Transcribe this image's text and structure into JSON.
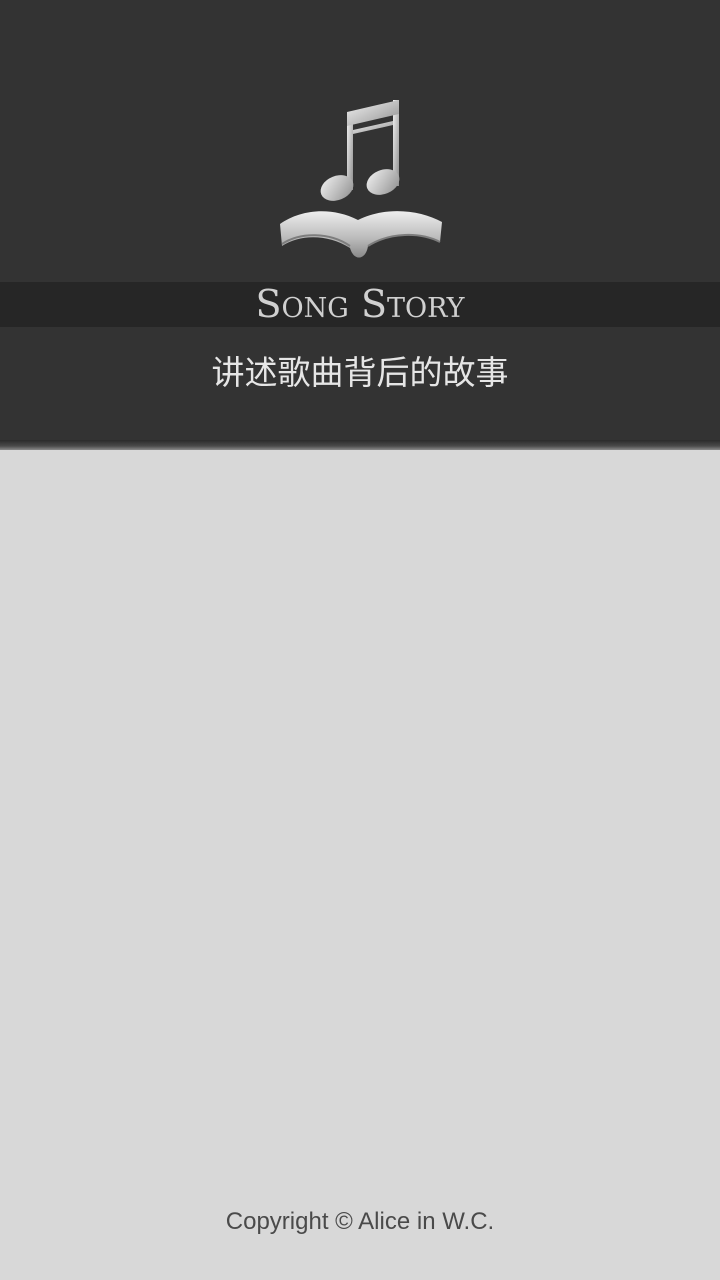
{
  "header": {
    "logo_icon": "music-note-book-icon",
    "app_title": "Song Story",
    "tagline": "讲述歌曲背后的故事"
  },
  "footer": {
    "copyright": "Copyright © Alice in W.C."
  },
  "colors": {
    "header_background": "#333333",
    "title_band": "#262626",
    "body_background": "#d8d8d8"
  }
}
